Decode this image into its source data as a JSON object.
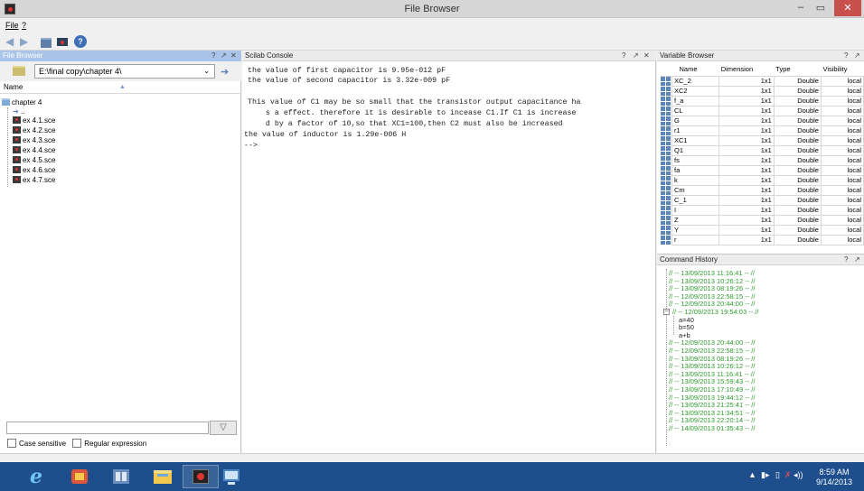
{
  "window": {
    "title": "File Browser",
    "minimize": "–",
    "maximize": "▭",
    "close": "✕"
  },
  "menu": [
    {
      "label": "File"
    },
    {
      "label": "?"
    }
  ],
  "file_browser": {
    "title": "File Browser",
    "path": "E:\\final copy\\chapter 4\\",
    "column_header": "Name",
    "root": "chapter 4",
    "up_item": "..",
    "files": [
      "ex 4.1.sce",
      "ex 4.2.sce",
      "ex 4.3.sce",
      "ex 4.4.sce",
      "ex 4.5.sce",
      "ex 4.6.sce",
      "ex 4.7.sce"
    ],
    "filter_value": "",
    "case_sensitive_label": "Case sensitive",
    "regex_label": "Regular expression"
  },
  "console": {
    "title": "Scilab Console",
    "lines": [
      "the value of first capacitor is 9.95e-012 pF",
      "the value of second capacitor is 3.32e-009 pF",
      "",
      "This value of C1 may be so small that the transistor output capacitance ha",
      "    s a effect. therefore it is desirable to incease C1.If C1 is increase",
      "    d by a factor of 10,so that XC1=100,then C2 must also be increased",
      "the value of inductor is 1.29e-006 H",
      "-->"
    ]
  },
  "variable_browser": {
    "title": "Variable Browser",
    "columns": [
      "Name",
      "Dimension",
      "Type",
      "Visibility"
    ],
    "rows": [
      {
        "name": "XC_2",
        "dim": "1x1",
        "type": "Double",
        "vis": "local"
      },
      {
        "name": "XC2",
        "dim": "1x1",
        "type": "Double",
        "vis": "local"
      },
      {
        "name": "f_a",
        "dim": "1x1",
        "type": "Double",
        "vis": "local"
      },
      {
        "name": "CL",
        "dim": "1x1",
        "type": "Double",
        "vis": "local"
      },
      {
        "name": "G",
        "dim": "1x1",
        "type": "Double",
        "vis": "local"
      },
      {
        "name": "r1",
        "dim": "1x1",
        "type": "Double",
        "vis": "local"
      },
      {
        "name": "XC1",
        "dim": "1x1",
        "type": "Double",
        "vis": "local"
      },
      {
        "name": "Q1",
        "dim": "1x1",
        "type": "Double",
        "vis": "local"
      },
      {
        "name": "fs",
        "dim": "1x1",
        "type": "Double",
        "vis": "local"
      },
      {
        "name": "fa",
        "dim": "1x1",
        "type": "Double",
        "vis": "local"
      },
      {
        "name": "k",
        "dim": "1x1",
        "type": "Double",
        "vis": "local"
      },
      {
        "name": "Cm",
        "dim": "1x1",
        "type": "Double",
        "vis": "local"
      },
      {
        "name": "C_1",
        "dim": "1x1",
        "type": "Double",
        "vis": "local"
      },
      {
        "name": "I",
        "dim": "1x1",
        "type": "Double",
        "vis": "local"
      },
      {
        "name": "Z",
        "dim": "1x1",
        "type": "Double",
        "vis": "local"
      },
      {
        "name": "Y",
        "dim": "1x1",
        "type": "Double",
        "vis": "local"
      },
      {
        "name": "r",
        "dim": "1x1",
        "type": "Double",
        "vis": "local"
      }
    ]
  },
  "command_history": {
    "title": "Command History",
    "sessions_before": [
      "// -- 13/09/2013 11:16:41 -- //",
      "// -- 13/09/2013 10:26:12 -- //",
      "// -- 13/09/2013 08:19:26 -- //",
      "// -- 12/09/2013 22:58:15 -- //",
      "// -- 12/09/2013 20:44:00 -- //"
    ],
    "expanded_session": "// -- 12/09/2013 19:54:03 -- //",
    "commands": [
      "a=40",
      "b=50",
      "a+b"
    ],
    "sessions_after": [
      "// -- 12/09/2013 20:44:00 -- //",
      "// -- 12/09/2013 22:58:15 -- //",
      "// -- 13/09/2013 08:19:26 -- //",
      "// -- 13/09/2013 10:26:12 -- //",
      "// -- 13/09/2013 11:16:41 -- //",
      "// -- 13/09/2013 15:59:43 -- //",
      "// -- 13/09/2013 17:10:49 -- //",
      "// -- 13/09/2013 19:44:12 -- //",
      "// -- 13/09/2013 21:25:41 -- //",
      "// -- 13/09/2013 21:34:51 -- //",
      "// -- 13/09/2013 22:20:14 -- //",
      "// -- 14/09/2013 01:35:43 -- //"
    ]
  },
  "panel_controls": {
    "help": "?",
    "undock": "↗",
    "close": "✕"
  },
  "taskbar": {
    "clock_time": "8:59 AM",
    "clock_date": "9/14/2013",
    "apps": [
      "ie-icon",
      "app-red-icon",
      "app-tools-icon",
      "file-explorer-icon",
      "scilab-icon",
      "remote-icon"
    ]
  },
  "colors": {
    "active_header": "#a9c4e8",
    "history_green": "#2f9a2f",
    "taskbar": "#1e4f8c",
    "close_button": "#c7504d"
  }
}
